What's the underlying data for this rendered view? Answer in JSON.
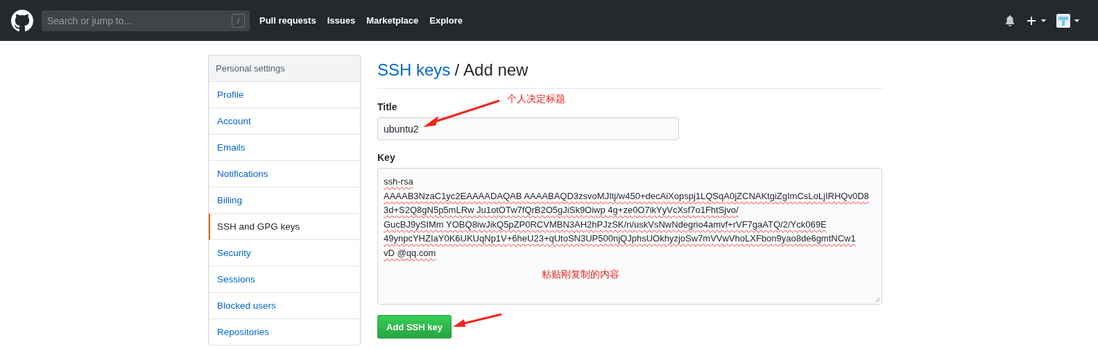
{
  "header": {
    "search": {
      "placeholder": "Search or jump to...",
      "shortcut": "/"
    },
    "nav": [
      "Pull requests",
      "Issues",
      "Marketplace",
      "Explore"
    ]
  },
  "sidebar": {
    "title": "Personal settings",
    "items": [
      {
        "label": "Profile",
        "selected": false
      },
      {
        "label": "Account",
        "selected": false
      },
      {
        "label": "Emails",
        "selected": false
      },
      {
        "label": "Notifications",
        "selected": false
      },
      {
        "label": "Billing",
        "selected": false
      },
      {
        "label": "SSH and GPG keys",
        "selected": true
      },
      {
        "label": "Security",
        "selected": false
      },
      {
        "label": "Sessions",
        "selected": false
      },
      {
        "label": "Blocked users",
        "selected": false
      },
      {
        "label": "Repositories",
        "selected": false
      }
    ]
  },
  "breadcrumb": {
    "link": "SSH keys",
    "separator": "/",
    "current": "Add new"
  },
  "form": {
    "title_label": "Title",
    "title_value": "ubuntu2",
    "key_label": "Key",
    "key_lines": [
      "ssh-rsa",
      "AAAAB3NzaC1yc2EAAAADAQAB AAAABAQD3zsvoMJItj/w450+decAiXopspj1LQSqA0jZCNAKtgiZgImCsLoLjIRHQv0D8",
      "3d+S2Q8gN5p5mLRw Ju1otOTw7fQrB2O5gJiSk9Oiwp 4g+ze0O7ikYyVcXsf7o1FhtSjvo/",
      "GucBJ9ySIMm YOBQ8iwJikQ5pZP0RCVMBN3AH2hPJzSK/n/uskVsNwNdegrio4amvf+rVF7gaATQ/2/Yck069E",
      "49ynpcYHZIaY0K6UKUqNp1V+6heU23+qUtoSN3UP500njQJphsUOkhyzjoSw7mVVwVhoLXFbon9yao8de6gmtNCw1",
      "vD @qq.com"
    ],
    "button": "Add SSH key"
  },
  "annotations": [
    "个人决定标题",
    "粘贴刚复制的内容"
  ]
}
